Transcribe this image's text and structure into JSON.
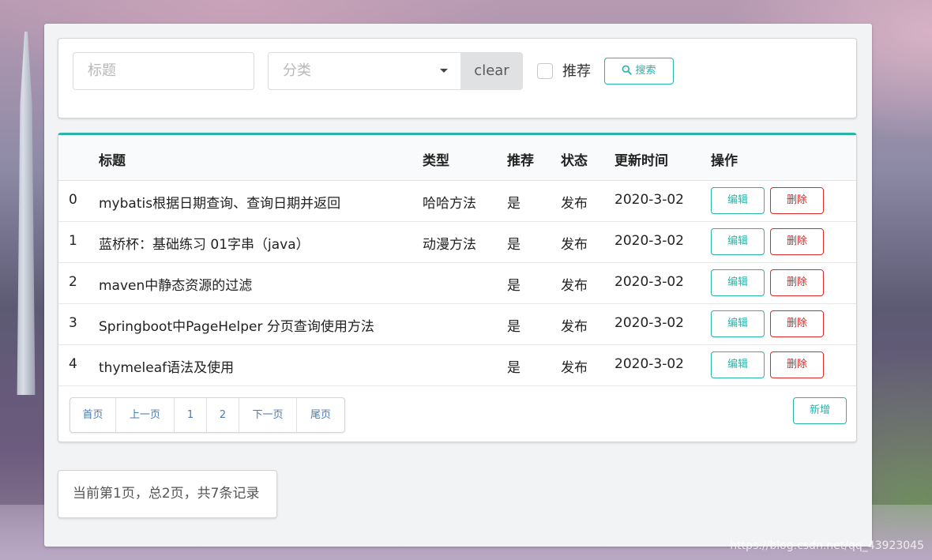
{
  "search": {
    "title_placeholder": "标题",
    "category_placeholder": "分类",
    "clear_label": "clear",
    "recommend_label": "推荐",
    "search_label": "搜索"
  },
  "table": {
    "headers": [
      "标题",
      "类型",
      "推荐",
      "状态",
      "更新时间",
      "操作"
    ],
    "rows": [
      {
        "index": "0",
        "title": "mybatis根据日期查询、查询日期并返回",
        "type": "哈哈方法",
        "recommend": "是",
        "status": "发布",
        "updated": "2020-3-02"
      },
      {
        "index": "1",
        "title": "蓝桥杯：基础练习 01字串（java）",
        "type": "动漫方法",
        "recommend": "是",
        "status": "发布",
        "updated": "2020-3-02"
      },
      {
        "index": "2",
        "title": "maven中静态资源的过滤",
        "type": "",
        "recommend": "是",
        "status": "发布",
        "updated": "2020-3-02"
      },
      {
        "index": "3",
        "title": "Springboot中PageHelper 分页查询使用方法",
        "type": "",
        "recommend": "是",
        "status": "发布",
        "updated": "2020-3-02"
      },
      {
        "index": "4",
        "title": "thymeleaf语法及使用",
        "type": "",
        "recommend": "是",
        "status": "发布",
        "updated": "2020-3-02"
      }
    ],
    "edit_label": "编辑",
    "delete_label": "删除"
  },
  "pagination": {
    "items": [
      "首页",
      "上一页",
      "1",
      "2",
      "下一页",
      "尾页"
    ]
  },
  "add_label": "新增",
  "page_info": "当前第1页，总2页，共7条记录",
  "watermark": "https://blog.csdn.net/qq_43923045",
  "colors": {
    "accent": "#2bb3a8",
    "danger": "#db2828"
  }
}
